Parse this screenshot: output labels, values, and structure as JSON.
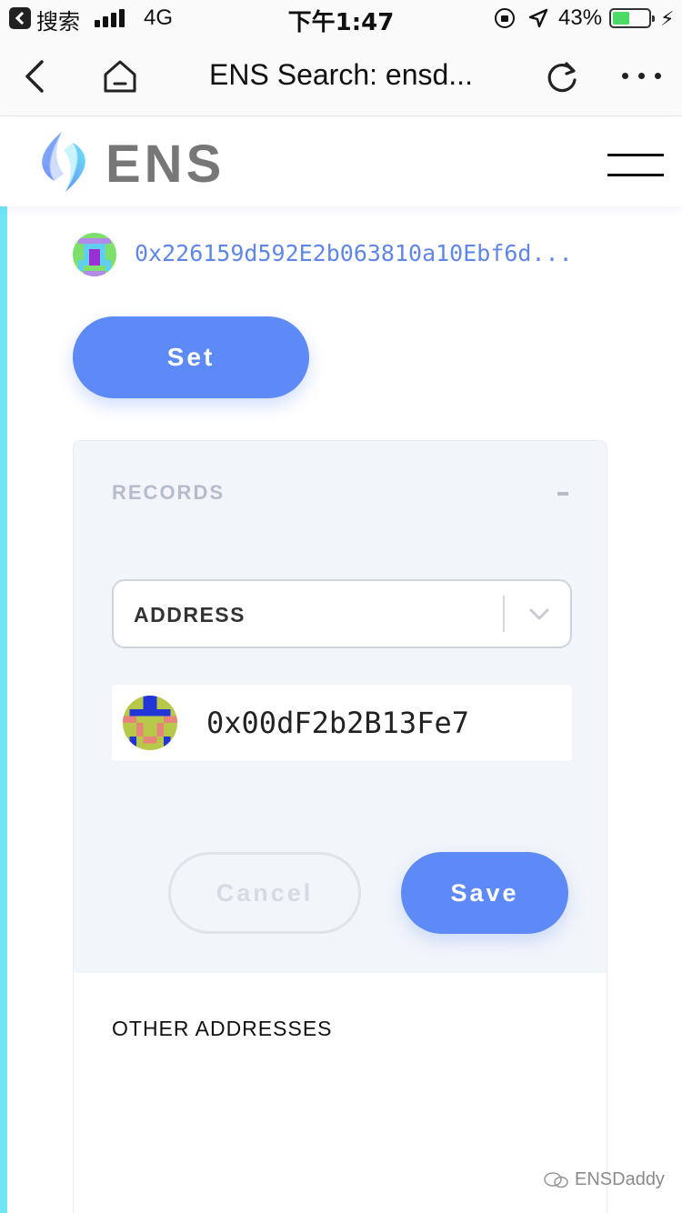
{
  "status_bar": {
    "app_label": "搜索",
    "network": "4G",
    "time": "下午1:47",
    "battery_percent": "43%",
    "battery_level": 0.43
  },
  "nav_bar": {
    "title": "ENS Search: ensd..."
  },
  "header": {
    "brand": "ENS",
    "brand_colors": [
      "#5e8af7",
      "#6ee5f5",
      "#8fb0f8"
    ]
  },
  "owner": {
    "address": "0x226159d592E2b063810a10Ebf6d..."
  },
  "buttons": {
    "set": "Set",
    "cancel": "Cancel",
    "save": "Save"
  },
  "records": {
    "title": "RECORDS",
    "collapse_symbol": "-",
    "record_type": "ADDRESS",
    "address_value": "0x00dF2b2B13Fe7"
  },
  "other_addresses": {
    "title": "OTHER ADDRESSES"
  },
  "watermark": {
    "text": "ENSDaddy"
  },
  "colors": {
    "accent": "#5e8af7",
    "address_link": "#5f86e8",
    "left_bar": "#6ee5f5",
    "panel_bg": "#f2f5fa"
  }
}
